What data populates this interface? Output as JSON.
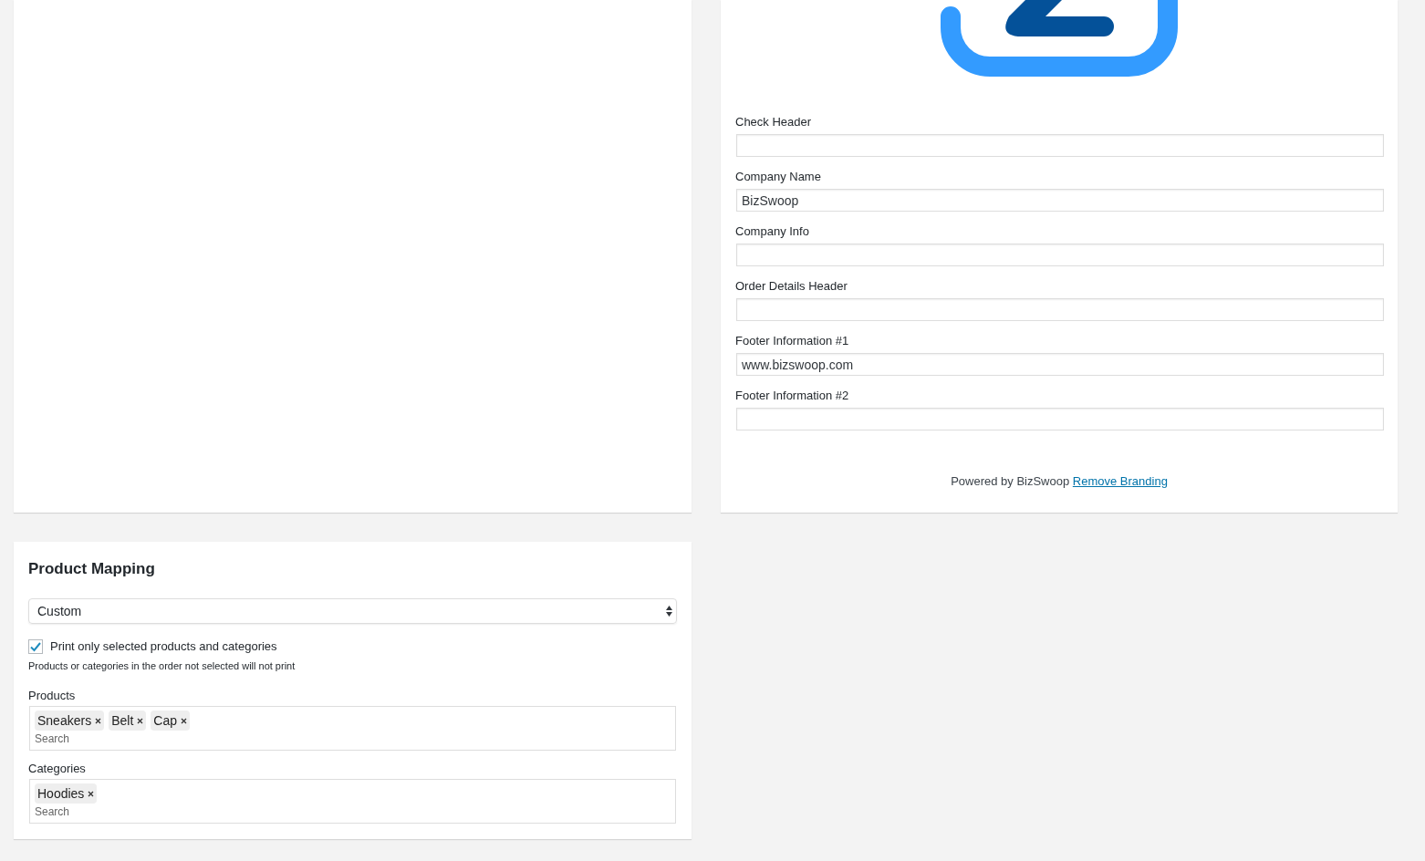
{
  "company_details": {
    "fields": [
      {
        "label": "Check Header"
      },
      {
        "label": "Company Name",
        "value": "BizSwoop"
      },
      {
        "label": "Company Info"
      },
      {
        "label": "Order Details Header"
      },
      {
        "label": "Footer Information #1",
        "value": "www.bizswoop.com"
      },
      {
        "label": "Footer Information #2"
      }
    ],
    "branding": {
      "text": "Powered by BizSwoop",
      "link": "Remove Branding"
    }
  },
  "product_mapping": {
    "title": "Product Mapping",
    "mode": "Custom",
    "print_only_selected": {
      "label": "Print only selected products and categories",
      "checked": true
    },
    "help": "Products or categories in the order not selected will not print",
    "pickers": [
      {
        "label": "Products",
        "tags": [
          "Sneakers",
          "Belt",
          "Cap"
        ],
        "placeholder": "Search"
      },
      {
        "label": "Categories",
        "tags": [
          "Hoodies"
        ],
        "placeholder": "Search"
      }
    ]
  }
}
